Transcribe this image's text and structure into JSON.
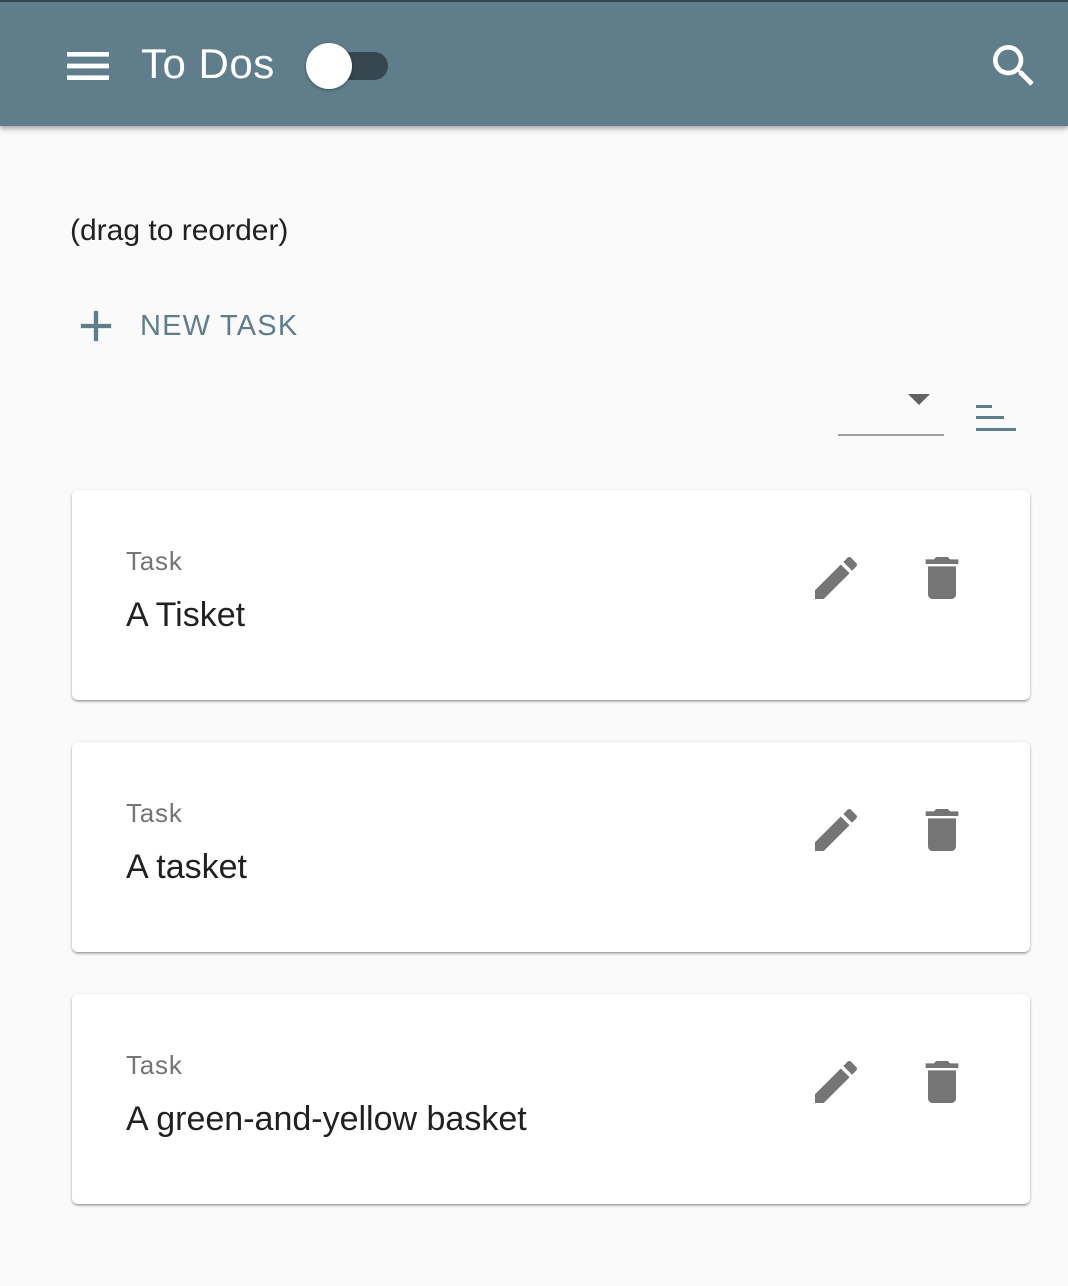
{
  "appbar": {
    "title": "To Dos",
    "menu_icon": "menu-icon",
    "search_icon": "search-icon",
    "toggle_on": false
  },
  "hint": "(drag to reorder)",
  "new_task": {
    "label": "NEW TASK",
    "icon": "plus-icon"
  },
  "sort": {
    "selected": "",
    "direction_icon": "sort-icon"
  },
  "tasks": [
    {
      "label": "Task",
      "title": "A Tisket"
    },
    {
      "label": "Task",
      "title": "A tasket"
    },
    {
      "label": "Task",
      "title": "A green-and-yellow basket"
    }
  ],
  "colors": {
    "appbar": "#607d8b",
    "appbar_border": "#37474f",
    "accent": "#607d8b",
    "background": "#fafafa",
    "icon": "#757575"
  }
}
